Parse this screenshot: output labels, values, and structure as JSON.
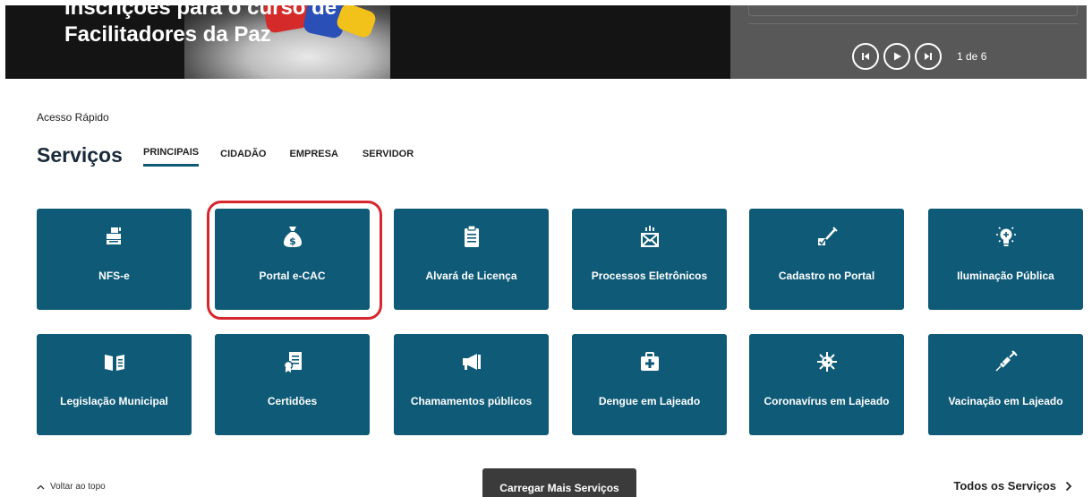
{
  "hero": {
    "title_line1": "Inscrições para o curso de",
    "title_line2": "Facilitadores da Paz",
    "slide_counter": "1 de 6"
  },
  "section": {
    "quick_access_label": "Acesso Rápido",
    "title": "Serviços"
  },
  "tabs": [
    {
      "label": "PRINCIPAIS",
      "active": true
    },
    {
      "label": "CIDADÃO",
      "active": false
    },
    {
      "label": "EMPRESA",
      "active": false
    },
    {
      "label": "SERVIDOR",
      "active": false
    }
  ],
  "cards": [
    {
      "label": "NFS-e",
      "icon": "printer-icon"
    },
    {
      "label": "Portal e-CAC",
      "icon": "money-bag-icon"
    },
    {
      "label": "Alvará de Licença",
      "icon": "clipboard-icon"
    },
    {
      "label": "Processos Eletrônicos",
      "icon": "envelope-icon"
    },
    {
      "label": "Cadastro no Portal",
      "icon": "pen-checkbox-icon"
    },
    {
      "label": "Iluminação Pública",
      "icon": "lightbulb-icon"
    },
    {
      "label": "Legislação Municipal",
      "icon": "open-book-icon"
    },
    {
      "label": "Certidões",
      "icon": "certificate-icon"
    },
    {
      "label": "Chamamentos públicos",
      "icon": "megaphone-icon"
    },
    {
      "label": "Dengue em Lajeado",
      "icon": "medkit-icon"
    },
    {
      "label": "Coronavírus em Lajeado",
      "icon": "virus-icon"
    },
    {
      "label": "Vacinação em Lajeado",
      "icon": "syringe-icon"
    }
  ],
  "footer": {
    "back_to_top": "Voltar ao topo",
    "load_more": "Carregar Mais Serviços",
    "all_services": "Todos os Serviços"
  },
  "colors": {
    "card_bg": "#0e5a77",
    "highlight": "#d7262e",
    "load_more_bg": "#3b3b3b"
  }
}
